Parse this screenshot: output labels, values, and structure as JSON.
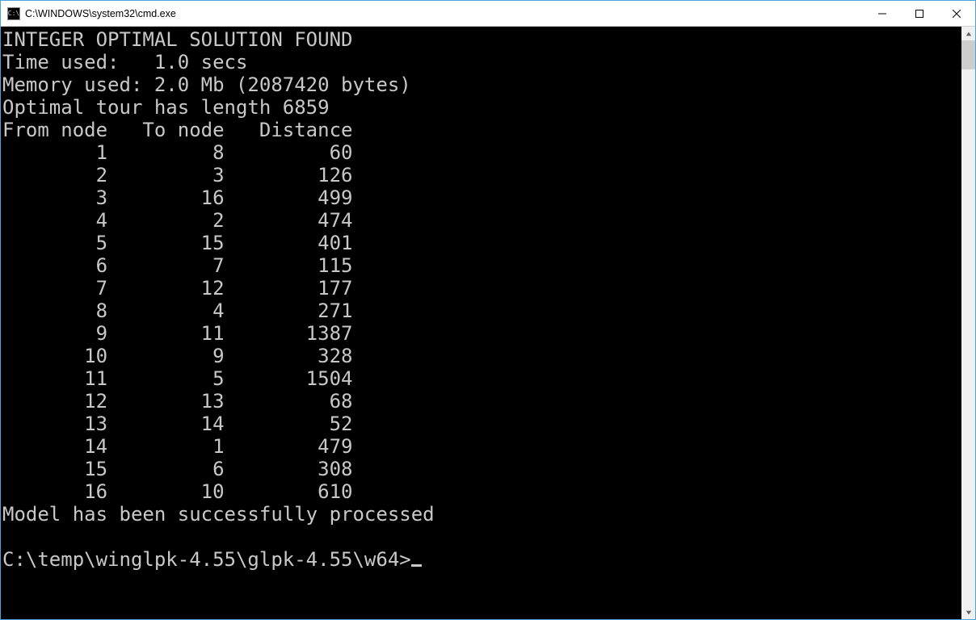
{
  "window": {
    "title": "C:\\WINDOWS\\system32\\cmd.exe"
  },
  "output": {
    "solution_line": "INTEGER OPTIMAL SOLUTION FOUND",
    "time_line": "Time used:   1.0 secs",
    "memory_line": "Memory used: 2.0 Mb (2087420 bytes)",
    "tour_line": "Optimal tour has length 6859",
    "header": {
      "from": "From node",
      "to": "To node",
      "distance": "Distance"
    },
    "rows": [
      {
        "from": 1,
        "to": 8,
        "dist": 60
      },
      {
        "from": 2,
        "to": 3,
        "dist": 126
      },
      {
        "from": 3,
        "to": 16,
        "dist": 499
      },
      {
        "from": 4,
        "to": 2,
        "dist": 474
      },
      {
        "from": 5,
        "to": 15,
        "dist": 401
      },
      {
        "from": 6,
        "to": 7,
        "dist": 115
      },
      {
        "from": 7,
        "to": 12,
        "dist": 177
      },
      {
        "from": 8,
        "to": 4,
        "dist": 271
      },
      {
        "from": 9,
        "to": 11,
        "dist": 1387
      },
      {
        "from": 10,
        "to": 9,
        "dist": 328
      },
      {
        "from": 11,
        "to": 5,
        "dist": 1504
      },
      {
        "from": 12,
        "to": 13,
        "dist": 68
      },
      {
        "from": 13,
        "to": 14,
        "dist": 52
      },
      {
        "from": 14,
        "to": 1,
        "dist": 479
      },
      {
        "from": 15,
        "to": 6,
        "dist": 308
      },
      {
        "from": 16,
        "to": 10,
        "dist": 610
      }
    ],
    "footer_line": "Model has been successfully processed",
    "prompt": "C:\\temp\\winglpk-4.55\\glpk-4.55\\w64>"
  }
}
